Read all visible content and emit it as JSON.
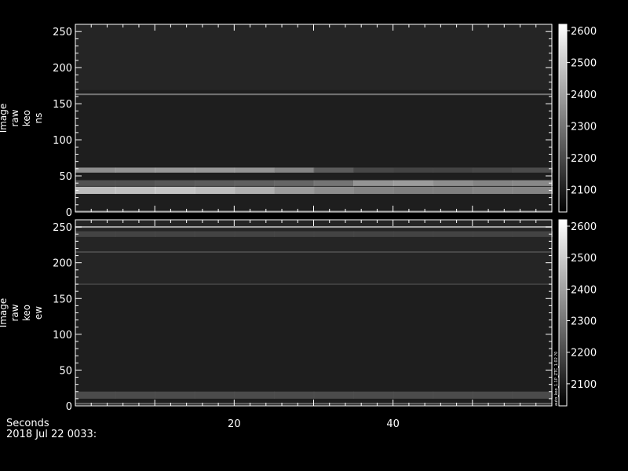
{
  "chart_data": [
    {
      "type": "heatmap",
      "panel_label": [
        "Image",
        "raw",
        "keo",
        "ns"
      ],
      "xlim": [
        0,
        60
      ],
      "ylim": [
        0,
        260
      ],
      "yticks": [
        0,
        50,
        100,
        150,
        200,
        250
      ],
      "xticks": [
        20,
        40
      ],
      "colorbar": {
        "range": [
          2030,
          2620
        ],
        "ticks": [
          2100,
          2200,
          2300,
          2400,
          2500,
          2600
        ]
      },
      "features": [
        {
          "kind": "band",
          "y": 30,
          "width": 10,
          "intensity": [
            0.78,
            0.8,
            0.82,
            0.78,
            0.72,
            0.62,
            0.55,
            0.5,
            0.48,
            0.48,
            0.5,
            0.5
          ]
        },
        {
          "kind": "band",
          "y": 40,
          "width": 8,
          "intensity": [
            0.25,
            0.25,
            0.28,
            0.3,
            0.32,
            0.35,
            0.42,
            0.58,
            0.62,
            0.55,
            0.5,
            0.52
          ]
        },
        {
          "kind": "band",
          "y": 58,
          "width": 7,
          "intensity": [
            0.55,
            0.58,
            0.6,
            0.6,
            0.58,
            0.5,
            0.3,
            0.2,
            0.18,
            0.18,
            0.2,
            0.22
          ]
        },
        {
          "kind": "line",
          "y": 163,
          "intensity": 0.35
        },
        {
          "kind": "line",
          "y": 1,
          "intensity": 0.25
        }
      ]
    },
    {
      "type": "heatmap",
      "panel_label": [
        "Image",
        "raw",
        "keo",
        "ew"
      ],
      "xlim": [
        0,
        60
      ],
      "ylim": [
        0,
        260
      ],
      "yticks": [
        0,
        50,
        100,
        150,
        200,
        250
      ],
      "xticks": [
        20,
        40
      ],
      "colorbar": {
        "range": [
          2030,
          2620
        ],
        "ticks": [
          2100,
          2200,
          2300,
          2400,
          2500,
          2600
        ]
      },
      "features": [
        {
          "kind": "line",
          "y": 250,
          "intensity": 0.6
        },
        {
          "kind": "band",
          "y": 240,
          "width": 8,
          "intensity": [
            0.18,
            0.18,
            0.18,
            0.18,
            0.18,
            0.18,
            0.18,
            0.18,
            0.18,
            0.18,
            0.18,
            0.18
          ]
        },
        {
          "kind": "line",
          "y": 215,
          "intensity": 0.15
        },
        {
          "kind": "line",
          "y": 170,
          "intensity": 0.1
        },
        {
          "kind": "band",
          "y": 15,
          "width": 10,
          "intensity": [
            0.22,
            0.22,
            0.22,
            0.22,
            0.22,
            0.22,
            0.22,
            0.22,
            0.22,
            0.22,
            0.22,
            0.22
          ]
        },
        {
          "kind": "line",
          "y": 3,
          "intensity": 0.3
        }
      ]
    }
  ],
  "colorbar_note": "auto_keo_1.1P_ZTC_1.02 ?0",
  "footer": {
    "x_axis_title": "Seconds",
    "date_label": "2018 Jul 22 0033:"
  }
}
